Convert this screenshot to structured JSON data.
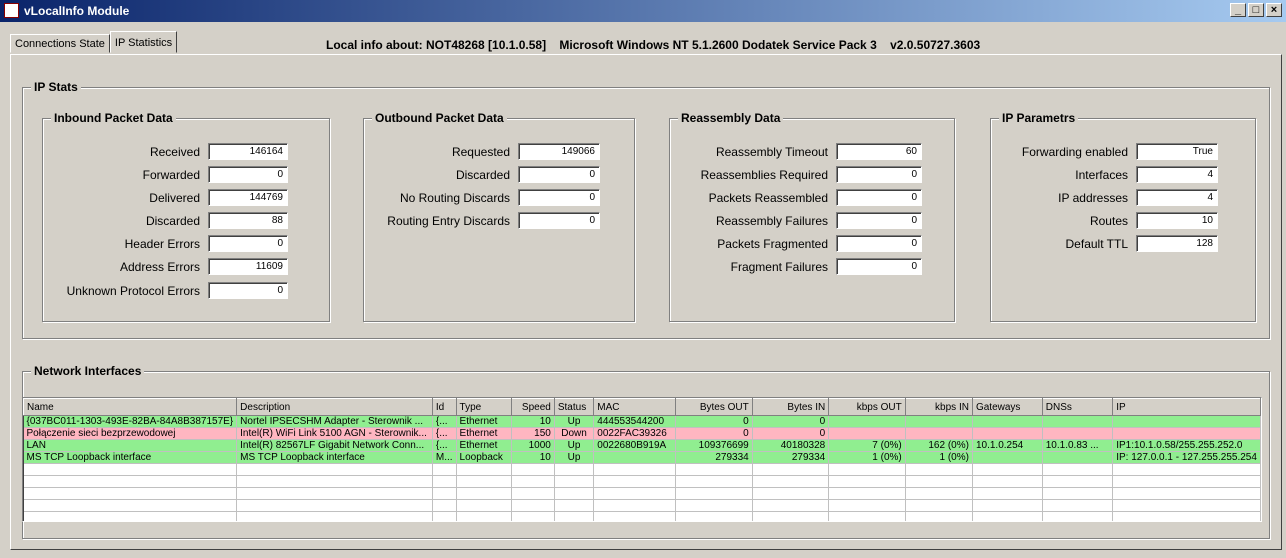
{
  "window": {
    "title": "vLocalInfo Module",
    "minimize": "_",
    "maximize": "□",
    "close": "×"
  },
  "tabs": [
    {
      "label": "Connections State"
    },
    {
      "label": "IP Statistics"
    }
  ],
  "info": {
    "text": "Local info about: NOT48268 [10.1.0.58]    Microsoft Windows NT 5.1.2600 Dodatek Service Pack 3    v2.0.50727.3603"
  },
  "ip_stats": {
    "title": "IP Stats",
    "inbound": {
      "title": "Inbound Packet Data",
      "fields": [
        {
          "label": "Received",
          "value": "146164"
        },
        {
          "label": "Forwarded",
          "value": "0"
        },
        {
          "label": "Delivered",
          "value": "144769"
        },
        {
          "label": "Discarded",
          "value": "88"
        },
        {
          "label": "Header Errors",
          "value": "0"
        },
        {
          "label": "Address Errors",
          "value": "11609"
        },
        {
          "label": "Unknown Protocol Errors",
          "value": "0"
        }
      ]
    },
    "outbound": {
      "title": "Outbound Packet Data",
      "fields": [
        {
          "label": "Requested",
          "value": "149066"
        },
        {
          "label": "Discarded",
          "value": "0"
        },
        {
          "label": "No Routing Discards",
          "value": "0"
        },
        {
          "label": "Routing Entry Discards",
          "value": "0"
        }
      ]
    },
    "reassembly": {
      "title": "Reassembly Data",
      "fields": [
        {
          "label": "Reassembly Timeout",
          "value": "60"
        },
        {
          "label": "Reassemblies Required",
          "value": "0"
        },
        {
          "label": "Packets Reassembled",
          "value": "0"
        },
        {
          "label": "Reassembly Failures",
          "value": "0"
        },
        {
          "label": "Packets Fragmented",
          "value": "0"
        },
        {
          "label": "Fragment Failures",
          "value": "0"
        }
      ]
    },
    "params": {
      "title": "IP Parametrs",
      "fields": [
        {
          "label": "Forwarding enabled",
          "value": "True"
        },
        {
          "label": "Interfaces",
          "value": "4"
        },
        {
          "label": "IP addresses",
          "value": "4"
        },
        {
          "label": "Routes",
          "value": "10"
        },
        {
          "label": "Default TTL",
          "value": "128"
        }
      ]
    }
  },
  "network": {
    "title": "Network Interfaces",
    "columns": [
      "Name",
      "Description",
      "Id",
      "Type",
      "Speed",
      "Status",
      "MAC",
      "Bytes OUT",
      "Bytes IN",
      "kbps OUT",
      "kbps IN",
      "Gateways",
      "DNSs",
      "IP"
    ],
    "rows": [
      {
        "color": "#90ee90",
        "cells": [
          "{037BC011-1303-493E-82BA-84A8B387157E}",
          "Nortel IPSECSHM Adapter - Sterownik ...",
          "{...",
          "Ethernet",
          "10",
          "Up",
          "444553544200",
          "0",
          "0",
          "",
          "",
          "",
          "",
          ""
        ]
      },
      {
        "color": "#ffb6c1",
        "cells": [
          "Połączenie sieci bezprzewodowej",
          "Intel(R) WiFi Link 5100 AGN - Sterownik...",
          "{...",
          "Ethernet",
          "150",
          "Down",
          "0022FAC39326",
          "0",
          "0",
          "",
          "",
          "",
          "",
          ""
        ]
      },
      {
        "color": "#90ee90",
        "cells": [
          "LAN",
          "Intel(R) 82567LF Gigabit Network Conn...",
          "{...",
          "Ethernet",
          "1000",
          "Up",
          "0022680B919A",
          "109376699",
          "40180328",
          "7 (0%)",
          "162 (0%)",
          "10.1.0.254",
          "10.1.0.83 ...",
          "IP1:10.1.0.58/255.255.252.0"
        ]
      },
      {
        "color": "#90ee90",
        "cells": [
          "MS TCP Loopback interface",
          "MS TCP Loopback interface",
          "M...",
          "Loopback",
          "10",
          "Up",
          "",
          "279334",
          "279334",
          "1 (0%)",
          "1 (0%)",
          "",
          "",
          "IP: 127.0.0.1 - 127.255.255.254"
        ]
      }
    ]
  }
}
